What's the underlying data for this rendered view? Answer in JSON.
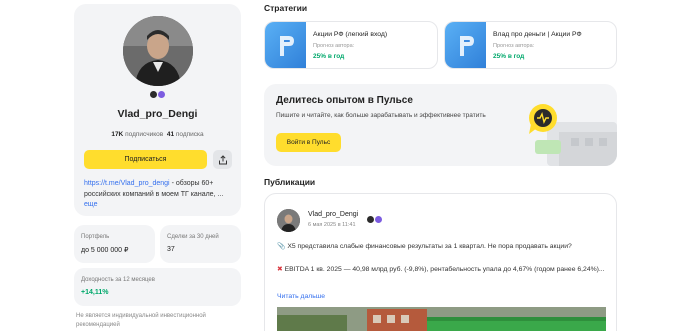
{
  "profile": {
    "name": "Vlad_pro_Dengi",
    "subscribers_count": "17K",
    "subscribers_label": "подписчиков",
    "following_count": "41",
    "following_label": "подписка",
    "subscribe_label": "Подписаться",
    "bio_link": "https://t.me/Vlad_pro_dengi",
    "bio_text": " - обзоры 60+ российских компаний в моем ТГ канале, ...",
    "bio_more": "еще"
  },
  "stats": {
    "portfolio_label": "Портфель",
    "portfolio_value": "до 5 000 000 ₽",
    "deals_label": "Сделки за 30 дней",
    "deals_value": "37",
    "yield_label": "Доходность за 12 месяцев",
    "yield_value": "+14,11%"
  },
  "disclaimer": "Не является индивидуальной инвестиционной рекомендацией",
  "strategies": {
    "title": "Стратегии",
    "items": [
      {
        "name": "Акции РФ (легкий вход)",
        "forecast_label": "Прогноз автора:",
        "forecast_value": "25% в год"
      },
      {
        "name": "Влад про деньги | Акции РФ",
        "forecast_label": "Прогноз автора:",
        "forecast_value": "25% в год"
      }
    ]
  },
  "promo": {
    "title": "Делитесь опытом в Пульсе",
    "text": "Пишите и читайте, как больше зарабатывать и эффективнее тратить",
    "button": "Войти в Пульс"
  },
  "publications": {
    "title": "Публикации",
    "post": {
      "author": "Vlad_pro_Dengi",
      "date": "6 мая 2025 в 11:41",
      "line1": "Х5 представила слабые финансовые результаты за 1 квартал. Не пора продавать акции?",
      "line2": "EBITDA 1 кв. 2025 — 40,98 млрд руб. (-9,8%), рентабельность упала до 4,67% (годом ранее 6,24%)...",
      "more": "Читать дальше"
    }
  },
  "colors": {
    "accent_yellow": "#ffdd2d",
    "link_blue": "#336fee",
    "positive_green": "#00a86b",
    "card_gray": "#f3f4f6"
  }
}
